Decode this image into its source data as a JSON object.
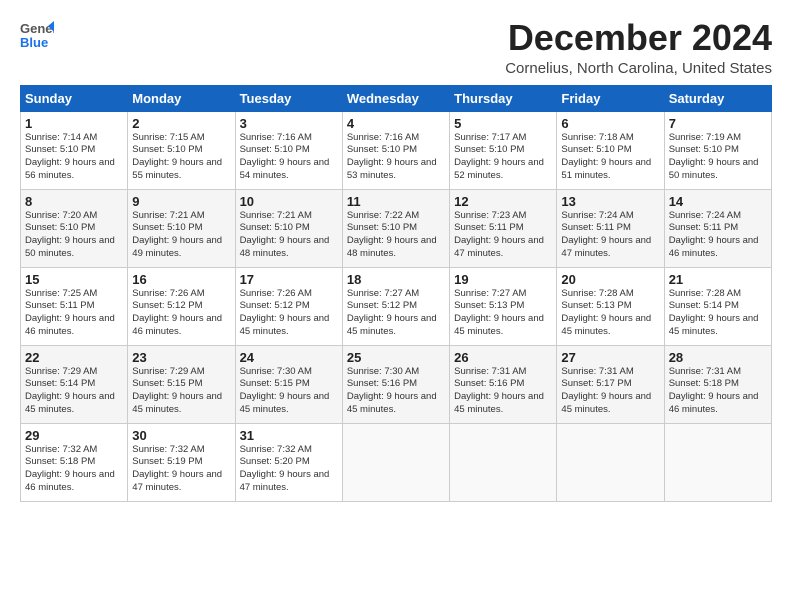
{
  "header": {
    "logo_general": "General",
    "logo_blue": "Blue",
    "month": "December 2024",
    "location": "Cornelius, North Carolina, United States"
  },
  "days_of_week": [
    "Sunday",
    "Monday",
    "Tuesday",
    "Wednesday",
    "Thursday",
    "Friday",
    "Saturday"
  ],
  "weeks": [
    [
      {
        "day": "1",
        "sunrise": "Sunrise: 7:14 AM",
        "sunset": "Sunset: 5:10 PM",
        "daylight": "Daylight: 9 hours and 56 minutes."
      },
      {
        "day": "2",
        "sunrise": "Sunrise: 7:15 AM",
        "sunset": "Sunset: 5:10 PM",
        "daylight": "Daylight: 9 hours and 55 minutes."
      },
      {
        "day": "3",
        "sunrise": "Sunrise: 7:16 AM",
        "sunset": "Sunset: 5:10 PM",
        "daylight": "Daylight: 9 hours and 54 minutes."
      },
      {
        "day": "4",
        "sunrise": "Sunrise: 7:16 AM",
        "sunset": "Sunset: 5:10 PM",
        "daylight": "Daylight: 9 hours and 53 minutes."
      },
      {
        "day": "5",
        "sunrise": "Sunrise: 7:17 AM",
        "sunset": "Sunset: 5:10 PM",
        "daylight": "Daylight: 9 hours and 52 minutes."
      },
      {
        "day": "6",
        "sunrise": "Sunrise: 7:18 AM",
        "sunset": "Sunset: 5:10 PM",
        "daylight": "Daylight: 9 hours and 51 minutes."
      },
      {
        "day": "7",
        "sunrise": "Sunrise: 7:19 AM",
        "sunset": "Sunset: 5:10 PM",
        "daylight": "Daylight: 9 hours and 50 minutes."
      }
    ],
    [
      {
        "day": "8",
        "sunrise": "Sunrise: 7:20 AM",
        "sunset": "Sunset: 5:10 PM",
        "daylight": "Daylight: 9 hours and 50 minutes."
      },
      {
        "day": "9",
        "sunrise": "Sunrise: 7:21 AM",
        "sunset": "Sunset: 5:10 PM",
        "daylight": "Daylight: 9 hours and 49 minutes."
      },
      {
        "day": "10",
        "sunrise": "Sunrise: 7:21 AM",
        "sunset": "Sunset: 5:10 PM",
        "daylight": "Daylight: 9 hours and 48 minutes."
      },
      {
        "day": "11",
        "sunrise": "Sunrise: 7:22 AM",
        "sunset": "Sunset: 5:10 PM",
        "daylight": "Daylight: 9 hours and 48 minutes."
      },
      {
        "day": "12",
        "sunrise": "Sunrise: 7:23 AM",
        "sunset": "Sunset: 5:11 PM",
        "daylight": "Daylight: 9 hours and 47 minutes."
      },
      {
        "day": "13",
        "sunrise": "Sunrise: 7:24 AM",
        "sunset": "Sunset: 5:11 PM",
        "daylight": "Daylight: 9 hours and 47 minutes."
      },
      {
        "day": "14",
        "sunrise": "Sunrise: 7:24 AM",
        "sunset": "Sunset: 5:11 PM",
        "daylight": "Daylight: 9 hours and 46 minutes."
      }
    ],
    [
      {
        "day": "15",
        "sunrise": "Sunrise: 7:25 AM",
        "sunset": "Sunset: 5:11 PM",
        "daylight": "Daylight: 9 hours and 46 minutes."
      },
      {
        "day": "16",
        "sunrise": "Sunrise: 7:26 AM",
        "sunset": "Sunset: 5:12 PM",
        "daylight": "Daylight: 9 hours and 46 minutes."
      },
      {
        "day": "17",
        "sunrise": "Sunrise: 7:26 AM",
        "sunset": "Sunset: 5:12 PM",
        "daylight": "Daylight: 9 hours and 45 minutes."
      },
      {
        "day": "18",
        "sunrise": "Sunrise: 7:27 AM",
        "sunset": "Sunset: 5:12 PM",
        "daylight": "Daylight: 9 hours and 45 minutes."
      },
      {
        "day": "19",
        "sunrise": "Sunrise: 7:27 AM",
        "sunset": "Sunset: 5:13 PM",
        "daylight": "Daylight: 9 hours and 45 minutes."
      },
      {
        "day": "20",
        "sunrise": "Sunrise: 7:28 AM",
        "sunset": "Sunset: 5:13 PM",
        "daylight": "Daylight: 9 hours and 45 minutes."
      },
      {
        "day": "21",
        "sunrise": "Sunrise: 7:28 AM",
        "sunset": "Sunset: 5:14 PM",
        "daylight": "Daylight: 9 hours and 45 minutes."
      }
    ],
    [
      {
        "day": "22",
        "sunrise": "Sunrise: 7:29 AM",
        "sunset": "Sunset: 5:14 PM",
        "daylight": "Daylight: 9 hours and 45 minutes."
      },
      {
        "day": "23",
        "sunrise": "Sunrise: 7:29 AM",
        "sunset": "Sunset: 5:15 PM",
        "daylight": "Daylight: 9 hours and 45 minutes."
      },
      {
        "day": "24",
        "sunrise": "Sunrise: 7:30 AM",
        "sunset": "Sunset: 5:15 PM",
        "daylight": "Daylight: 9 hours and 45 minutes."
      },
      {
        "day": "25",
        "sunrise": "Sunrise: 7:30 AM",
        "sunset": "Sunset: 5:16 PM",
        "daylight": "Daylight: 9 hours and 45 minutes."
      },
      {
        "day": "26",
        "sunrise": "Sunrise: 7:31 AM",
        "sunset": "Sunset: 5:16 PM",
        "daylight": "Daylight: 9 hours and 45 minutes."
      },
      {
        "day": "27",
        "sunrise": "Sunrise: 7:31 AM",
        "sunset": "Sunset: 5:17 PM",
        "daylight": "Daylight: 9 hours and 45 minutes."
      },
      {
        "day": "28",
        "sunrise": "Sunrise: 7:31 AM",
        "sunset": "Sunset: 5:18 PM",
        "daylight": "Daylight: 9 hours and 46 minutes."
      }
    ],
    [
      {
        "day": "29",
        "sunrise": "Sunrise: 7:32 AM",
        "sunset": "Sunset: 5:18 PM",
        "daylight": "Daylight: 9 hours and 46 minutes."
      },
      {
        "day": "30",
        "sunrise": "Sunrise: 7:32 AM",
        "sunset": "Sunset: 5:19 PM",
        "daylight": "Daylight: 9 hours and 47 minutes."
      },
      {
        "day": "31",
        "sunrise": "Sunrise: 7:32 AM",
        "sunset": "Sunset: 5:20 PM",
        "daylight": "Daylight: 9 hours and 47 minutes."
      },
      null,
      null,
      null,
      null
    ]
  ]
}
